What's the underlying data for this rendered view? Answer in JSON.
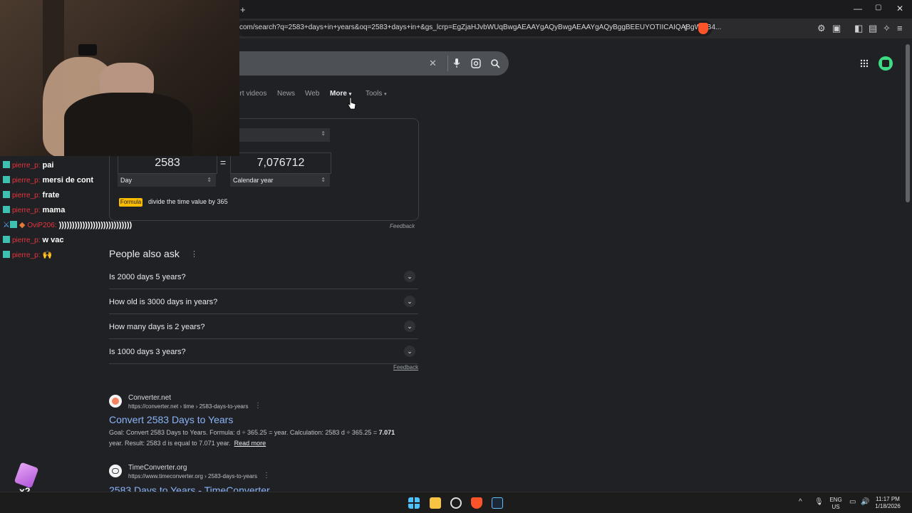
{
  "browser": {
    "new_tab_symbol": "+",
    "url": "com/search?q=2583+days+in+years&oq=2583+days+in+&gs_lcrp=EgZjaHJvbWUqBwgAEAAYgAQyBwgAEAAYgAQyBggBEEUYOTIICAIQABgWGB4...",
    "window_controls": {
      "minimize": "—",
      "maximize": "▢",
      "close": "✕"
    }
  },
  "search": {
    "close_symbol": "✕"
  },
  "tabs": [
    {
      "label": "ort videos"
    },
    {
      "label": "News"
    },
    {
      "label": "Web"
    },
    {
      "label": "More"
    },
    {
      "label": "Tools"
    }
  ],
  "converter": {
    "from_value": "2583",
    "equals": "=",
    "to_value": "7,076712",
    "from_unit": "Day",
    "to_unit": "Calendar year",
    "formula_badge": "Formula",
    "formula_text": "divide the time value by 365",
    "feedback": "Feedback"
  },
  "paa": {
    "title": "People also ask",
    "questions": [
      "Is 2000 days 5 years?",
      "How old is 3000 days in years?",
      "How many days is 2 years?",
      "Is 1000 days 3 years?"
    ],
    "feedback": "Feedback"
  },
  "results": [
    {
      "site": "Converter.net",
      "breadcrumb": "https://converter.net › time › 2583-days-to-years",
      "title": "Convert 2583 Days to Years",
      "snippet_1": "Goal: Convert 2583 Days to Years. Formula: d ÷ 365.25 = year. Calculation: 2583 d ÷ 365.25 = ",
      "snippet_bold": "7.071",
      "snippet_2": "year. Result: 2583 d is equal to 7.071 year.",
      "read_more": "Read more"
    },
    {
      "site": "TimeConverter.org",
      "breadcrumb": "https://www.timeconverter.org › 2583-days-to-years",
      "title": "2583 Days to Years - TimeConverter"
    }
  ],
  "chat": {
    "lines": [
      {
        "user": "pierre_p:",
        "message": "pai"
      },
      {
        "user": "pierre_p:",
        "message": "mersi de cont"
      },
      {
        "user": "pierre_p:",
        "message": "frate"
      },
      {
        "user": "pierre_p:",
        "message": "mama"
      },
      {
        "user": "OviP206:",
        "message": "))))))))))))))))))))))))))))"
      },
      {
        "user": "pierre_p:",
        "message": "w vac"
      },
      {
        "user": "pierre_p:",
        "message": "🙌"
      }
    ]
  },
  "overlay": {
    "multiplier": "x2"
  },
  "taskbar": {
    "language_top": "ENG",
    "language_bottom": "US",
    "time": "11:17 PM",
    "date": "1/18/2026"
  },
  "colors": {
    "page_bg": "#202124",
    "link_blue": "#8ab4f8",
    "chat_username": "#e8353f",
    "formula_badge": "#fbbc04"
  }
}
